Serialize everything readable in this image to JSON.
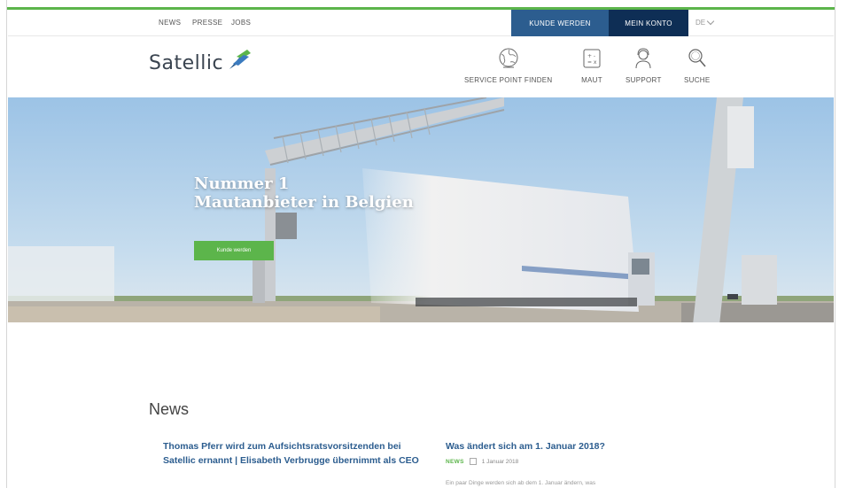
{
  "utility": {
    "links": [
      "NEWS",
      "PRESSE",
      "JOBS"
    ],
    "kunde_button": "KUNDE WERDEN",
    "konto_button": "MEIN KONTO",
    "language": "DE"
  },
  "header": {
    "logo_text": "Satellic",
    "nav": [
      {
        "label": "SERVICE POINT FINDEN",
        "icon": "globe-icon"
      },
      {
        "label": "MAUT",
        "icon": "calculator-icon"
      },
      {
        "label": "SUPPORT",
        "icon": "support-agent-icon"
      },
      {
        "label": "SUCHE",
        "icon": "search-icon"
      }
    ]
  },
  "hero": {
    "title_line1": "Nummer 1",
    "title_line2": "Mautanbieter in Belgien",
    "button": "Kunde werden"
  },
  "news": {
    "heading": "News",
    "articles": [
      {
        "title": "Thomas Pferr wird zum Aufsichtsratsvorsitzenden bei Satellic ernannt | Elisabeth Verbrugge übernimmt als CEO"
      },
      {
        "title": "Was ändert sich am 1. Januar 2018?",
        "tag": "NEWS",
        "date": "1 Januar 2018",
        "excerpt": "Ein paar Dinge werden sich ab dem 1. Januar ändern, was"
      }
    ]
  },
  "colors": {
    "brand_green": "#5cb54b",
    "brand_blue": "#2c5d8f",
    "dark_navy": "#0e2e55"
  }
}
